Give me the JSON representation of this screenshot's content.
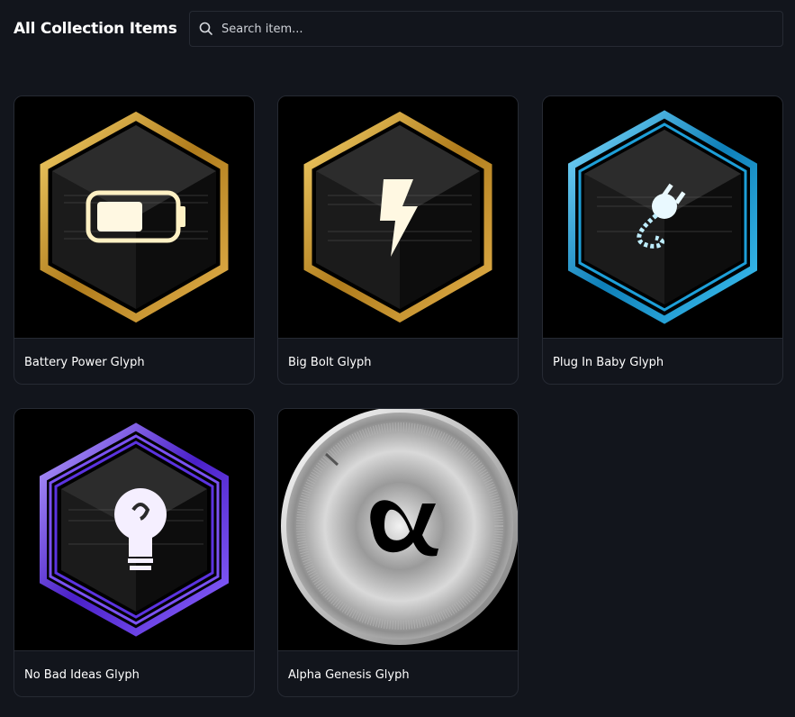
{
  "header": {
    "title": "All Collection Items"
  },
  "search": {
    "placeholder": "Search item..."
  },
  "items": [
    {
      "name": "Battery Power Glyph",
      "icon": "battery-icon",
      "frame_color": "#c8952a",
      "glow_color": "#fff4cf"
    },
    {
      "name": "Big Bolt Glyph",
      "icon": "lightning-bolt-icon",
      "frame_color": "#c8952a",
      "glow_color": "#fff4cf"
    },
    {
      "name": "Plug In Baby Glyph",
      "icon": "plug-icon",
      "frame_color": "#1da9e0",
      "glow_color": "#dff6ff"
    },
    {
      "name": "No Bad Ideas Glyph",
      "icon": "light-bulb-icon",
      "frame_color": "#6d3ff0",
      "glow_color": "#f2eaff"
    },
    {
      "name": "Alpha Genesis Glyph",
      "icon": "alpha-icon",
      "frame_color": "#c9c9c9",
      "glow_color": "#000000"
    }
  ]
}
